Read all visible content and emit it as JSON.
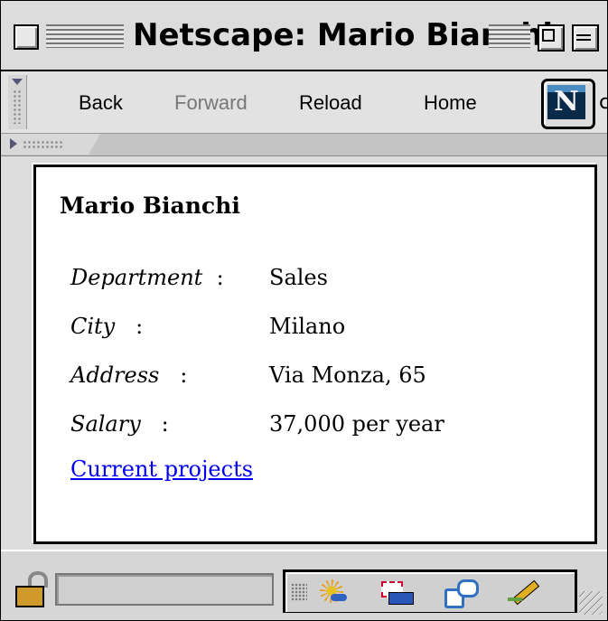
{
  "window": {
    "title": "Netscape: Mario Bianchi"
  },
  "toolbar": {
    "back": "Back",
    "forward": "Forward",
    "reload": "Reload",
    "home": "Home",
    "logo_letter": "N",
    "overflow_fragment": "c"
  },
  "page": {
    "heading": "Mario Bianchi",
    "rows": [
      {
        "label": "Department",
        "sep": ":",
        "value": "Sales"
      },
      {
        "label": "City",
        "sep": ":",
        "value": "Milano"
      },
      {
        "label": "Address",
        "sep": ":",
        "value": "Via Monza, 65"
      },
      {
        "label": "Salary",
        "sep": ":",
        "value": "37,000 per year"
      }
    ],
    "link": "Current projects"
  },
  "status": {
    "security": "unlocked",
    "icons": [
      "navigator-icon",
      "mail-icon",
      "composer-icon",
      "editor-icon"
    ]
  }
}
